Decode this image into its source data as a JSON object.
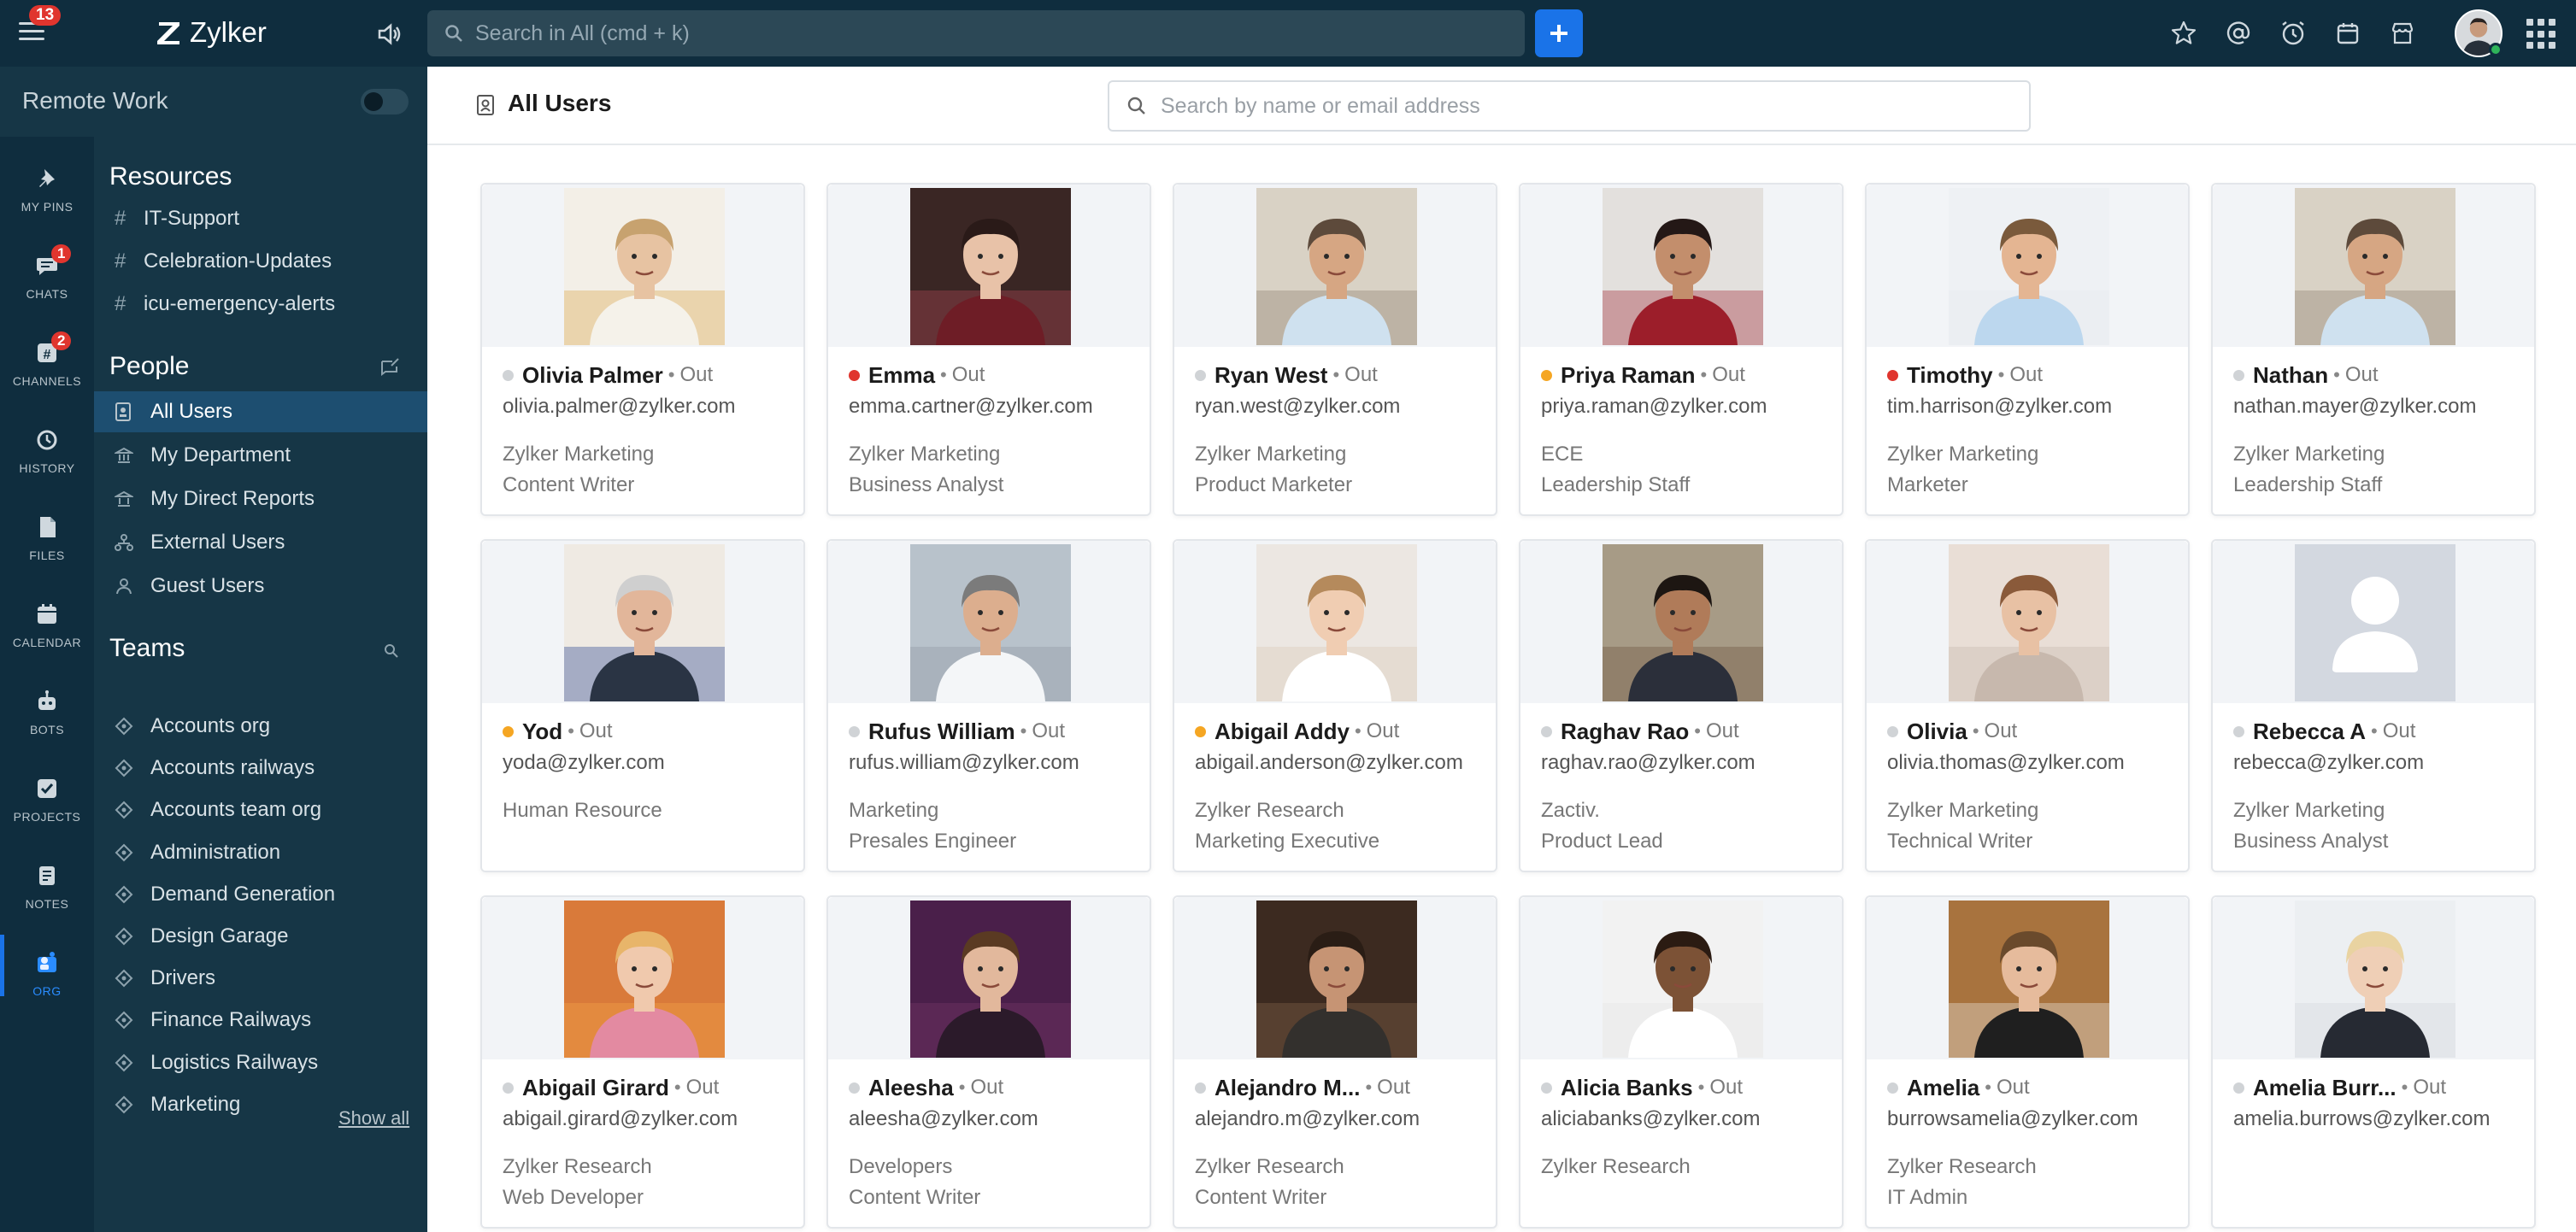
{
  "topbar": {
    "notification_count": "13",
    "app_name": "Zylker",
    "search_placeholder": "Search in All (cmd + k)",
    "icons": [
      "star-icon",
      "mention-icon",
      "alarm-icon",
      "calendar-icon",
      "store-icon"
    ],
    "accent": "#1a73e8"
  },
  "workspace": {
    "name": "Remote Work",
    "toggle_on": false
  },
  "rail": [
    {
      "label": "MY PINS",
      "count": ""
    },
    {
      "label": "CHATS",
      "count": "1"
    },
    {
      "label": "CHANNELS",
      "count": "2"
    },
    {
      "label": "HISTORY",
      "count": ""
    },
    {
      "label": "FILES",
      "count": ""
    },
    {
      "label": "CALENDAR",
      "count": ""
    },
    {
      "label": "BOTS",
      "count": ""
    },
    {
      "label": "PROJECTS",
      "count": ""
    },
    {
      "label": "NOTES",
      "count": ""
    },
    {
      "label": "ORG",
      "count": "",
      "active": true
    }
  ],
  "sidebar": {
    "resources_title": "Resources",
    "resources": [
      "IT-Support",
      "Celebration-Updates",
      "icu-emergency-alerts"
    ],
    "people_title": "People",
    "people": [
      "All Users",
      "My Department",
      "My Direct Reports",
      "External Users",
      "Guest Users"
    ],
    "teams_title": "Teams",
    "teams": [
      "Accounts org",
      "Accounts railways",
      "Accounts team org",
      "Administration",
      "Demand Generation",
      "Design Garage",
      "Drivers",
      "Finance Railways",
      "Logistics Railways",
      "Marketing"
    ],
    "show_all": "Show all"
  },
  "main": {
    "title": "All Users",
    "search_placeholder": "Search by name or email address"
  },
  "users": [
    {
      "name": "Olivia Palmer",
      "status": "Out",
      "email": "olivia.palmer@zylker.com",
      "org": "Zylker Marketing",
      "role": "Content Writer",
      "dot": "#d0d3d6"
    },
    {
      "name": "Emma",
      "status": "Out",
      "email": "emma.cartner@zylker.com",
      "org": "Zylker Marketing",
      "role": "Business Analyst",
      "dot": "#e0352e"
    },
    {
      "name": "Ryan West",
      "status": "Out",
      "email": "ryan.west@zylker.com",
      "org": "Zylker Marketing",
      "role": "Product Marketer",
      "dot": "#d0d3d6"
    },
    {
      "name": "Priya Raman",
      "status": "Out",
      "email": "priya.raman@zylker.com",
      "org": "ECE",
      "role": "Leadership Staff",
      "dot": "#f5a623"
    },
    {
      "name": "Timothy",
      "status": "Out",
      "email": "tim.harrison@zylker.com",
      "org": "Zylker Marketing",
      "role": "Marketer",
      "dot": "#e0352e"
    },
    {
      "name": "Nathan",
      "status": "Out",
      "email": "nathan.mayer@zylker.com",
      "org": "Zylker Marketing",
      "role": "Leadership Staff",
      "dot": "#d0d3d6"
    },
    {
      "name": "Yod",
      "status": "Out",
      "email": "yoda@zylker.com",
      "org": "Human Resource",
      "role": "",
      "dot": "#f5a623"
    },
    {
      "name": "Rufus William",
      "status": "Out",
      "email": "rufus.william@zylker.com",
      "org": "Marketing",
      "role": "Presales Engineer",
      "dot": "#d0d3d6"
    },
    {
      "name": "Abigail Addy",
      "status": "Out",
      "email": "abigail.anderson@zylker.com",
      "org": "Zylker Research",
      "role": "Marketing Executive",
      "dot": "#f5a623"
    },
    {
      "name": "Raghav Rao",
      "status": "Out",
      "email": "raghav.rao@zylker.com",
      "org": "Zactiv.",
      "role": "Product Lead",
      "dot": "#d0d3d6"
    },
    {
      "name": "Olivia",
      "status": "Out",
      "email": "olivia.thomas@zylker.com",
      "org": "Zylker Marketing",
      "role": "Technical Writer",
      "dot": "#d0d3d6"
    },
    {
      "name": "Rebecca A",
      "status": "Out",
      "email": "rebecca@zylker.com",
      "org": "Zylker Marketing",
      "role": "Business Analyst",
      "dot": "#d0d3d6",
      "placeholder": true
    },
    {
      "name": "Abigail Girard",
      "status": "Out",
      "email": "abigail.girard@zylker.com",
      "org": "Zylker Research",
      "role": "Web Developer",
      "dot": "#d0d3d6"
    },
    {
      "name": "Aleesha",
      "status": "Out",
      "email": "aleesha@zylker.com",
      "org": "Developers",
      "role": "Content Writer",
      "dot": "#d0d3d6"
    },
    {
      "name": "Alejandro M...",
      "status": "Out",
      "email": "alejandro.m@zylker.com",
      "org": "Zylker Research",
      "role": "Content Writer",
      "dot": "#d0d3d6"
    },
    {
      "name": "Alicia Banks",
      "status": "Out",
      "email": "aliciabanks@zylker.com",
      "org": "Zylker Research",
      "role": "",
      "dot": "#d0d3d6"
    },
    {
      "name": "Amelia",
      "status": "Out",
      "email": "burrowsamelia@zylker.com",
      "org": "Zylker Research",
      "role": "IT Admin",
      "dot": "#d0d3d6"
    },
    {
      "name": "Amelia Burr...",
      "status": "Out",
      "email": "amelia.burrows@zylker.com",
      "org": "",
      "role": "",
      "dot": "#d0d3d6"
    }
  ]
}
